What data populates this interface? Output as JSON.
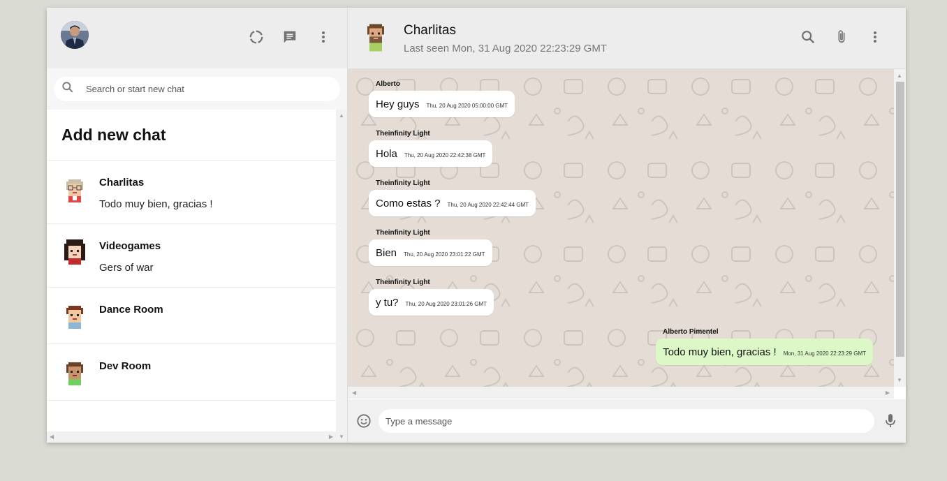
{
  "colors": {
    "page_bg": "#dadbd3",
    "header_bg": "#ededed",
    "chat_bg": "#e5ddd5",
    "own_bubble": "#dcf8c6",
    "icon": "#919191"
  },
  "sidebar": {
    "avatar_alt": "user avatar",
    "icons": [
      "status-icon",
      "new-chat-icon",
      "menu-icon"
    ],
    "search": {
      "placeholder": "Search or start new chat",
      "value": ""
    },
    "add_new_chat_label": "Add new chat",
    "chats": [
      {
        "name": "Charlitas",
        "last_message": "Todo muy bien, gracias !"
      },
      {
        "name": "Videogames",
        "last_message": "Gers of war"
      },
      {
        "name": "Dance Room",
        "last_message": ""
      },
      {
        "name": "Dev Room",
        "last_message": ""
      }
    ]
  },
  "chat": {
    "title": "Charlitas",
    "subtitle": "Last seen Mon, 31 Aug 2020 22:23:29 GMT",
    "icons": [
      "search-icon",
      "attach-icon",
      "menu-icon"
    ],
    "messages": [
      {
        "sender": "Alberto",
        "body": "Hey guys",
        "time": "Thu, 20 Aug 2020 05:00:00 GMT",
        "mine": false
      },
      {
        "sender": "Theinfinity Light",
        "body": "Hola",
        "time": "Thu, 20 Aug 2020 22:42:38 GMT",
        "mine": false
      },
      {
        "sender": "Theinfinity Light",
        "body": "Como estas ?",
        "time": "Thu, 20 Aug 2020 22:42:44 GMT",
        "mine": false
      },
      {
        "sender": "Theinfinity Light",
        "body": "Bien",
        "time": "Thu, 20 Aug 2020 23:01:22 GMT",
        "mine": false
      },
      {
        "sender": "Theinfinity Light",
        "body": "y tu?",
        "time": "Thu, 20 Aug 2020 23:01:26 GMT",
        "mine": false
      },
      {
        "sender": "Alberto Pimentel",
        "body": "Todo muy bien, gracias !",
        "time": "Mon, 31 Aug 2020 22:23:29 GMT",
        "mine": true
      }
    ],
    "composer": {
      "placeholder": "Type a message",
      "value": ""
    }
  }
}
